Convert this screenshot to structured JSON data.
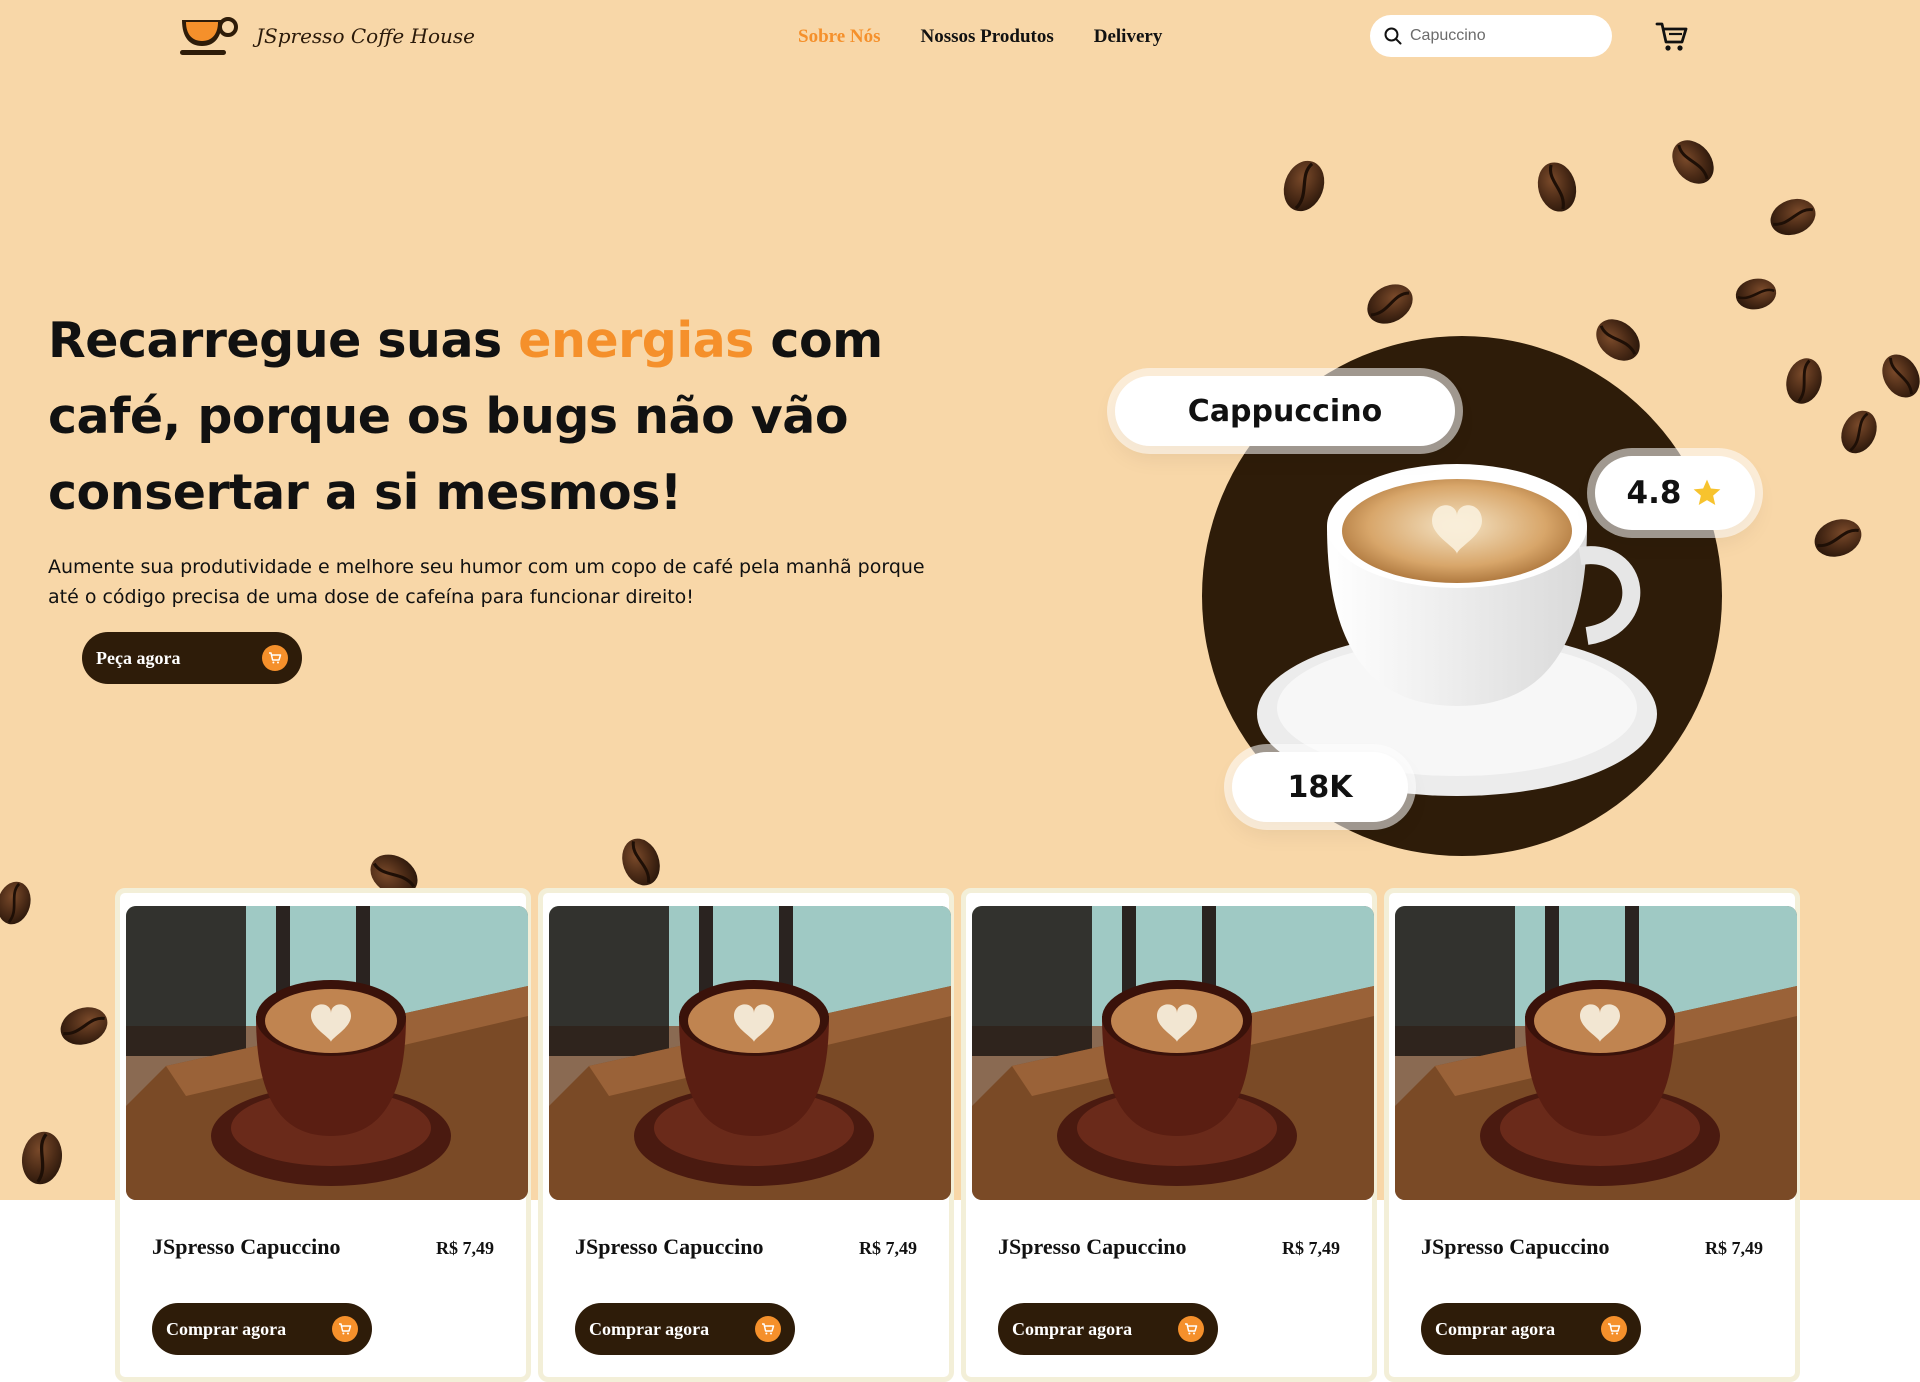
{
  "brand": {
    "name": "JSpresso Coffe House"
  },
  "nav": {
    "items": [
      {
        "label": "Sobre Nós",
        "active": true
      },
      {
        "label": "Nossos Produtos",
        "active": false
      },
      {
        "label": "Delivery",
        "active": false
      }
    ]
  },
  "search": {
    "placeholder": "Capuccino"
  },
  "hero": {
    "headline_1": "Recarregue suas ",
    "headline_accent": "energias",
    "headline_2": " com café, porque os bugs não vão consertar a si mesmos!",
    "subtext": "Aumente sua produtividade e melhore seu humor com um copo de café pela manhã porque até o código precisa de uma dose de cafeína para funcionar direito!",
    "cta_label": "Peça agora"
  },
  "featured": {
    "name": "Cappuccino",
    "rating": "4.8",
    "count": "18K"
  },
  "products": [
    {
      "name": "JSpresso Capuccino",
      "price": "R$ 7,49",
      "button": "Comprar agora"
    },
    {
      "name": "JSpresso Capuccino",
      "price": "R$ 7,49",
      "button": "Comprar agora"
    },
    {
      "name": "JSpresso Capuccino",
      "price": "R$ 7,49",
      "button": "Comprar agora"
    },
    {
      "name": "JSpresso Capuccino",
      "price": "R$ 7,49",
      "button": "Comprar agora"
    }
  ],
  "colors": {
    "accent": "#f5902b",
    "dark": "#2e1c09",
    "hero_bg": "#f8d7a8",
    "card_border": "#f3efd8"
  },
  "icons": [
    "cup-logo-icon",
    "search-icon",
    "cart-icon",
    "star-icon",
    "coffee-bean-icon"
  ]
}
